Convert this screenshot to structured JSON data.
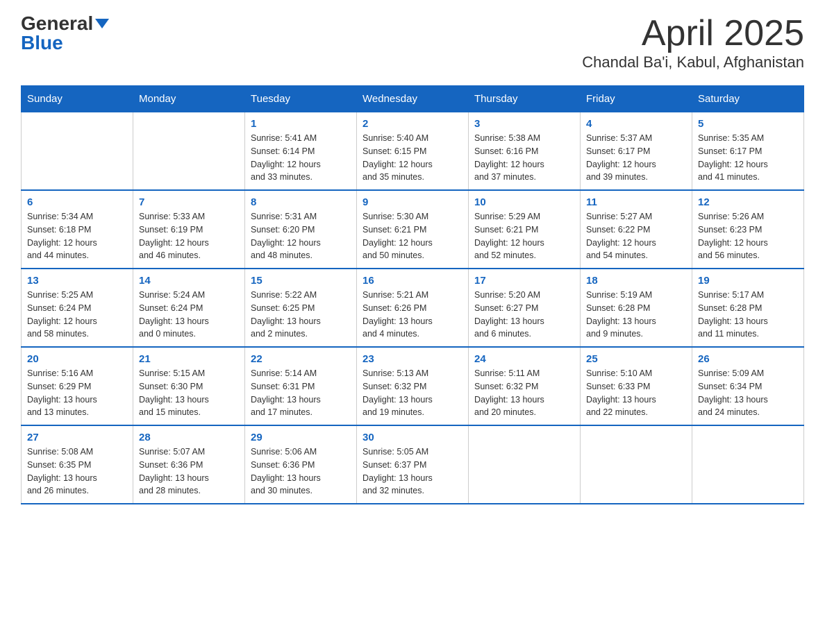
{
  "header": {
    "logo_general": "General",
    "logo_blue": "Blue",
    "title": "April 2025",
    "subtitle": "Chandal Ba'i, Kabul, Afghanistan"
  },
  "calendar": {
    "weekdays": [
      "Sunday",
      "Monday",
      "Tuesday",
      "Wednesday",
      "Thursday",
      "Friday",
      "Saturday"
    ],
    "weeks": [
      [
        {
          "day": "",
          "info": ""
        },
        {
          "day": "",
          "info": ""
        },
        {
          "day": "1",
          "info": "Sunrise: 5:41 AM\nSunset: 6:14 PM\nDaylight: 12 hours\nand 33 minutes."
        },
        {
          "day": "2",
          "info": "Sunrise: 5:40 AM\nSunset: 6:15 PM\nDaylight: 12 hours\nand 35 minutes."
        },
        {
          "day": "3",
          "info": "Sunrise: 5:38 AM\nSunset: 6:16 PM\nDaylight: 12 hours\nand 37 minutes."
        },
        {
          "day": "4",
          "info": "Sunrise: 5:37 AM\nSunset: 6:17 PM\nDaylight: 12 hours\nand 39 minutes."
        },
        {
          "day": "5",
          "info": "Sunrise: 5:35 AM\nSunset: 6:17 PM\nDaylight: 12 hours\nand 41 minutes."
        }
      ],
      [
        {
          "day": "6",
          "info": "Sunrise: 5:34 AM\nSunset: 6:18 PM\nDaylight: 12 hours\nand 44 minutes."
        },
        {
          "day": "7",
          "info": "Sunrise: 5:33 AM\nSunset: 6:19 PM\nDaylight: 12 hours\nand 46 minutes."
        },
        {
          "day": "8",
          "info": "Sunrise: 5:31 AM\nSunset: 6:20 PM\nDaylight: 12 hours\nand 48 minutes."
        },
        {
          "day": "9",
          "info": "Sunrise: 5:30 AM\nSunset: 6:21 PM\nDaylight: 12 hours\nand 50 minutes."
        },
        {
          "day": "10",
          "info": "Sunrise: 5:29 AM\nSunset: 6:21 PM\nDaylight: 12 hours\nand 52 minutes."
        },
        {
          "day": "11",
          "info": "Sunrise: 5:27 AM\nSunset: 6:22 PM\nDaylight: 12 hours\nand 54 minutes."
        },
        {
          "day": "12",
          "info": "Sunrise: 5:26 AM\nSunset: 6:23 PM\nDaylight: 12 hours\nand 56 minutes."
        }
      ],
      [
        {
          "day": "13",
          "info": "Sunrise: 5:25 AM\nSunset: 6:24 PM\nDaylight: 12 hours\nand 58 minutes."
        },
        {
          "day": "14",
          "info": "Sunrise: 5:24 AM\nSunset: 6:24 PM\nDaylight: 13 hours\nand 0 minutes."
        },
        {
          "day": "15",
          "info": "Sunrise: 5:22 AM\nSunset: 6:25 PM\nDaylight: 13 hours\nand 2 minutes."
        },
        {
          "day": "16",
          "info": "Sunrise: 5:21 AM\nSunset: 6:26 PM\nDaylight: 13 hours\nand 4 minutes."
        },
        {
          "day": "17",
          "info": "Sunrise: 5:20 AM\nSunset: 6:27 PM\nDaylight: 13 hours\nand 6 minutes."
        },
        {
          "day": "18",
          "info": "Sunrise: 5:19 AM\nSunset: 6:28 PM\nDaylight: 13 hours\nand 9 minutes."
        },
        {
          "day": "19",
          "info": "Sunrise: 5:17 AM\nSunset: 6:28 PM\nDaylight: 13 hours\nand 11 minutes."
        }
      ],
      [
        {
          "day": "20",
          "info": "Sunrise: 5:16 AM\nSunset: 6:29 PM\nDaylight: 13 hours\nand 13 minutes."
        },
        {
          "day": "21",
          "info": "Sunrise: 5:15 AM\nSunset: 6:30 PM\nDaylight: 13 hours\nand 15 minutes."
        },
        {
          "day": "22",
          "info": "Sunrise: 5:14 AM\nSunset: 6:31 PM\nDaylight: 13 hours\nand 17 minutes."
        },
        {
          "day": "23",
          "info": "Sunrise: 5:13 AM\nSunset: 6:32 PM\nDaylight: 13 hours\nand 19 minutes."
        },
        {
          "day": "24",
          "info": "Sunrise: 5:11 AM\nSunset: 6:32 PM\nDaylight: 13 hours\nand 20 minutes."
        },
        {
          "day": "25",
          "info": "Sunrise: 5:10 AM\nSunset: 6:33 PM\nDaylight: 13 hours\nand 22 minutes."
        },
        {
          "day": "26",
          "info": "Sunrise: 5:09 AM\nSunset: 6:34 PM\nDaylight: 13 hours\nand 24 minutes."
        }
      ],
      [
        {
          "day": "27",
          "info": "Sunrise: 5:08 AM\nSunset: 6:35 PM\nDaylight: 13 hours\nand 26 minutes."
        },
        {
          "day": "28",
          "info": "Sunrise: 5:07 AM\nSunset: 6:36 PM\nDaylight: 13 hours\nand 28 minutes."
        },
        {
          "day": "29",
          "info": "Sunrise: 5:06 AM\nSunset: 6:36 PM\nDaylight: 13 hours\nand 30 minutes."
        },
        {
          "day": "30",
          "info": "Sunrise: 5:05 AM\nSunset: 6:37 PM\nDaylight: 13 hours\nand 32 minutes."
        },
        {
          "day": "",
          "info": ""
        },
        {
          "day": "",
          "info": ""
        },
        {
          "day": "",
          "info": ""
        }
      ]
    ]
  }
}
